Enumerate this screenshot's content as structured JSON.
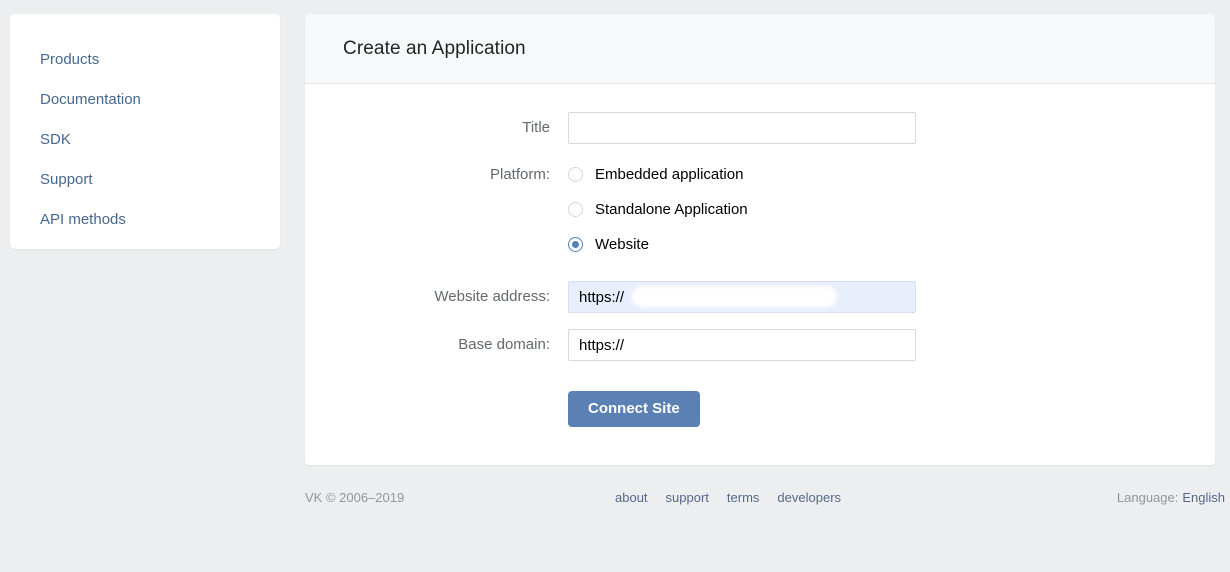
{
  "sidebar": {
    "items": [
      {
        "label": "Products",
        "name": "sidebar-item-products"
      },
      {
        "label": "Documentation",
        "name": "sidebar-item-documentation"
      },
      {
        "label": "SDK",
        "name": "sidebar-item-sdk"
      },
      {
        "label": "Support",
        "name": "sidebar-item-support"
      },
      {
        "label": "API methods",
        "name": "sidebar-item-api-methods"
      }
    ]
  },
  "panel": {
    "title": "Create an Application"
  },
  "form": {
    "title_label": "Title",
    "title_value": "",
    "title_placeholder": "",
    "platform_label": "Platform:",
    "platform_options": [
      {
        "label": "Embedded application",
        "selected": false
      },
      {
        "label": "Standalone Application",
        "selected": false
      },
      {
        "label": "Website",
        "selected": true
      }
    ],
    "website_address_label": "Website address:",
    "website_address_value": "https://",
    "base_domain_label": "Base domain:",
    "base_domain_value": "https://",
    "submit_label": "Connect Site"
  },
  "footer": {
    "copyright": "VK © 2006–2019",
    "links": [
      {
        "label": "about"
      },
      {
        "label": "support"
      },
      {
        "label": "terms"
      },
      {
        "label": "developers"
      }
    ],
    "language_label": "Language:",
    "language_value": "English"
  },
  "colors": {
    "page_background": "#edeef0",
    "accent_blue": "#5181b8",
    "button_blue": "#5b80b4",
    "link_blue": "#45688e",
    "footer_link": "#55688e",
    "label_gray": "#62696d",
    "highlight_field": "#e8eefb"
  }
}
